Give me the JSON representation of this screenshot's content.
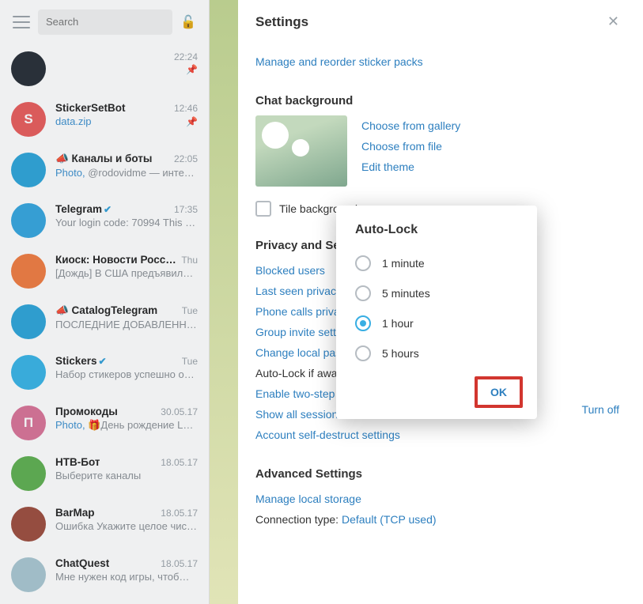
{
  "header": {
    "search_placeholder": "Search"
  },
  "chats": [
    {
      "name": "",
      "msg": "",
      "time": "22:24",
      "pin": "📌",
      "avatar_bg": "#232a33"
    },
    {
      "name": "StickerSetBot",
      "msg_hl": "data.zip",
      "msg": "",
      "time": "12:46",
      "pin": "📌",
      "avatar_bg": "#e85a59",
      "avatar_letter": "S"
    },
    {
      "name_prefix": "📣 ",
      "name": "Каналы и боты",
      "msg_hl": "Photo, ",
      "msg": "@rodovidme — инте…",
      "time": "22:05",
      "avatar_bg": "#2aa3d8"
    },
    {
      "name": "Telegram",
      "verified": "✔",
      "msg": "Your login code: 70994  This c…",
      "time": "17:35",
      "avatar_bg": "#32a4de"
    },
    {
      "name": "Киоск: Новости России",
      "msg": "[Дождь]  В США предъявил…",
      "time": "Thu",
      "avatar_bg": "#f07a3e"
    },
    {
      "name_prefix": "📣 ",
      "name": "CatalogTelegram",
      "msg": "ПОСЛЕДНИЕ ДОБАВЛЕННЫ…",
      "time": "Tue",
      "avatar_bg": "#2aa3d8"
    },
    {
      "name": "Stickers",
      "verified": "✔",
      "msg": "Набор стикеров успешно о…",
      "time": "Tue",
      "avatar_bg": "#35b3e6"
    },
    {
      "name": "Промокоды",
      "msg_hl": "Photo, ",
      "msg": "🎁День рождение L…",
      "time": "30.05.17",
      "avatar_bg": "#d87196",
      "avatar_letter": "П"
    },
    {
      "name": "НТВ-Бот",
      "msg": "Выберите каналы",
      "time": "18.05.17",
      "avatar_bg": "#5cae4d"
    },
    {
      "name": "BarMap",
      "msg": "Ошибка Укажите целое чис…",
      "time": "18.05.17",
      "avatar_bg": "#9b4a3a"
    },
    {
      "name": "ChatQuest",
      "msg": "Мне нужен код игры, чтоб…",
      "time": "18.05.17",
      "avatar_bg": "#a8c6d1"
    }
  ],
  "settings": {
    "title": "Settings",
    "sticker_link": "Manage and reorder sticker packs",
    "chat_bg_title": "Chat background",
    "choose_gallery": "Choose from gallery",
    "choose_file": "Choose from file",
    "edit_theme": "Edit theme",
    "tile_bg": "Tile background",
    "privacy_title": "Privacy and Security",
    "blocked_users": "Blocked users",
    "last_seen": "Last seen privacy",
    "phone_calls": "Phone calls privacy",
    "group_invite": "Group invite settings",
    "change_local": "Change local passcode",
    "turn_off": "Turn off",
    "autolock_label": "Auto-Lock if away for: ",
    "autolock_value": "1 hour",
    "two_step": "Enable two-step verification",
    "show_sessions": "Show all sessions",
    "self_destruct": "Account self-destruct settings",
    "advanced_title": "Advanced Settings",
    "manage_storage": "Manage local storage",
    "conn_label": "Connection type: ",
    "conn_value": "Default (TCP used)"
  },
  "dialog": {
    "title": "Auto-Lock",
    "options": [
      "1 minute",
      "5 minutes",
      "1 hour",
      "5 hours"
    ],
    "selected": "1 hour",
    "ok": "OK"
  }
}
